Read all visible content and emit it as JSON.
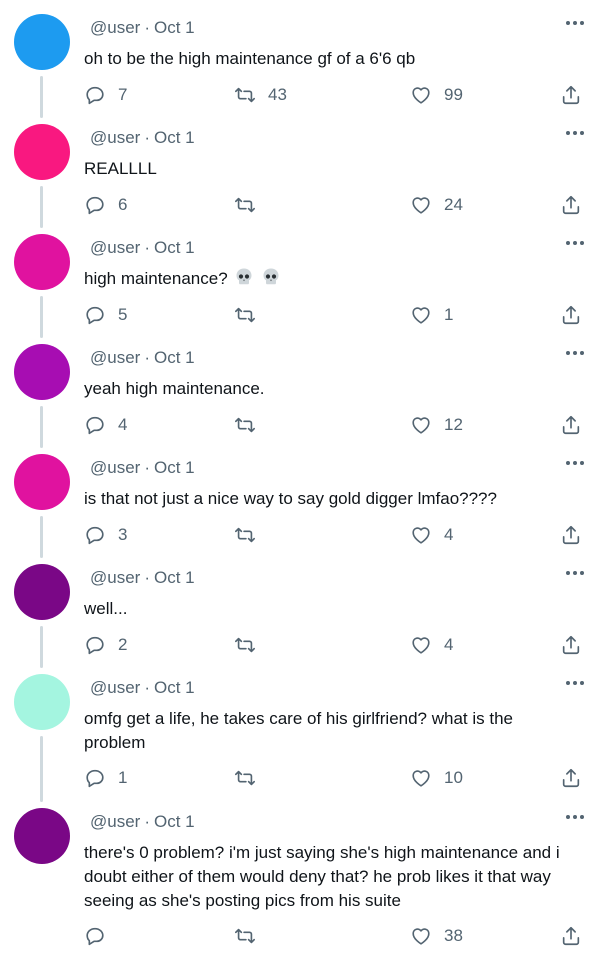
{
  "tweets": [
    {
      "handle": "@user",
      "date": "Oct 1",
      "text": "oh to be the high maintenance gf of a 6'6 qb",
      "replies": "7",
      "retweets": "43",
      "likes": "99",
      "avatar_color": "#1d9bf0"
    },
    {
      "handle": "@user",
      "date": "Oct 1",
      "text": "REALLLL",
      "replies": "6",
      "retweets": "",
      "likes": "24",
      "avatar_color": "#f91880"
    },
    {
      "handle": "@user",
      "date": "Oct 1",
      "text": "high maintenance?",
      "emoji": "skull skull",
      "replies": "5",
      "retweets": "",
      "likes": "1",
      "avatar_color": "#e0129f"
    },
    {
      "handle": "@user",
      "date": "Oct 1",
      "text": "yeah high maintenance.",
      "replies": "4",
      "retweets": "",
      "likes": "12",
      "avatar_color": "#a70db2"
    },
    {
      "handle": "@user",
      "date": "Oct 1",
      "text": "is that not just a nice way to say gold digger lmfao????",
      "replies": "3",
      "retweets": "",
      "likes": "4",
      "avatar_color": "#e0129f"
    },
    {
      "handle": "@user",
      "date": "Oct 1",
      "text": "well...",
      "replies": "2",
      "retweets": "",
      "likes": "4",
      "avatar_color": "#7a0786"
    },
    {
      "handle": "@user",
      "date": "Oct 1",
      "text": "omfg get a life, he takes care of his girlfriend? what is the problem",
      "replies": "1",
      "retweets": "",
      "likes": "10",
      "avatar_color": "#a4f5e0"
    },
    {
      "handle": "@user",
      "date": "Oct 1",
      "text": "there's 0 problem? i'm just saying she's high maintenance and i doubt either of them would deny that? he prob likes it that way seeing as she's posting pics from his suite",
      "replies": "",
      "retweets": "",
      "likes": "38",
      "avatar_color": "#7a0786"
    }
  ],
  "icons": {
    "reply": "reply-icon",
    "retweet": "retweet-icon",
    "like": "heart-icon",
    "share": "share-icon",
    "more": "more-icon",
    "emoji": "skull-emoji"
  },
  "colors": {
    "secondary_text": "#536471",
    "thread_line": "#cfd9de"
  }
}
